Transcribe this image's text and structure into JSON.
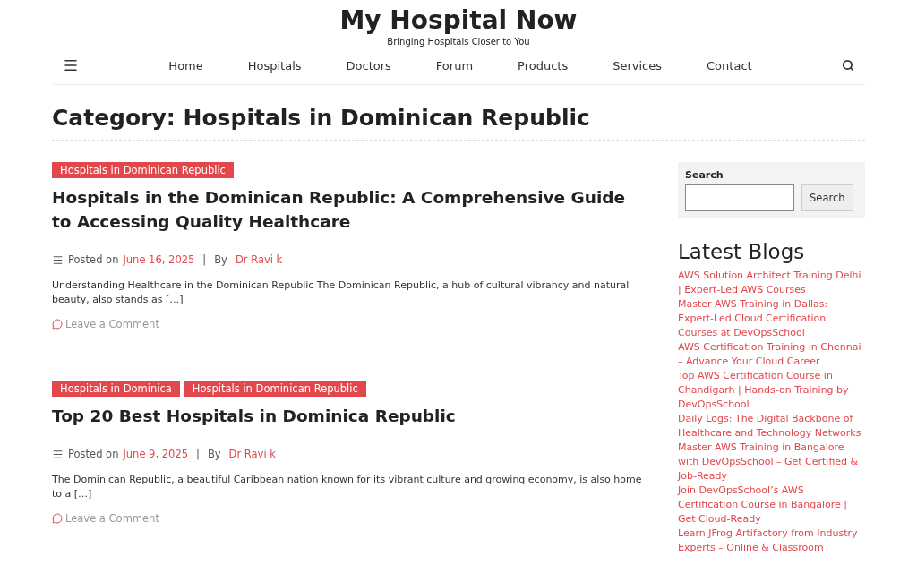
{
  "site": {
    "title": "My Hospital Now",
    "tagline": "Bringing Hospitals Closer to You"
  },
  "nav": [
    "Home",
    "Hospitals",
    "Doctors",
    "Forum",
    "Products",
    "Services",
    "Contact"
  ],
  "page_title": "Category: Hospitals in Dominican Republic",
  "posts": [
    {
      "tags": [
        "Hospitals in Dominican Republic"
      ],
      "title": "Hospitals in the Dominican Republic: A Comprehensive Guide to Accessing Quality Healthcare",
      "posted_label": "Posted on",
      "date": "June 16, 2025",
      "separator": "|",
      "by_label": "By",
      "author": "Dr Ravi k",
      "excerpt": "Understanding Healthcare in the Dominican Republic The Dominican Republic, a hub of cultural vibrancy and natural beauty, also stands as […]",
      "comment_link": "Leave a Comment"
    },
    {
      "tags": [
        "Hospitals in Dominica",
        "Hospitals in Dominican Republic"
      ],
      "title": "Top 20 Best Hospitals in Dominica Republic",
      "posted_label": "Posted on",
      "date": "June 9, 2025",
      "separator": "|",
      "by_label": "By",
      "author": "Dr Ravi k",
      "excerpt": "The Dominican Republic, a beautiful Caribbean nation known for its vibrant culture and growing economy, is also home to a […]",
      "comment_link": "Leave a Comment"
    }
  ],
  "sidebar": {
    "search": {
      "label": "Search",
      "button": "Search"
    },
    "latest_title": "Latest Blogs",
    "latest": [
      "AWS Solution Architect Training Delhi | Expert-Led AWS Courses",
      "Master AWS Training in Dallas: Expert-Led Cloud Certification Courses at DevOpsSchool",
      "AWS Certification Training in Chennai – Advance Your Cloud Career",
      "Top AWS Certification Course in Chandigarh | Hands-on Training by DevOpsSchool",
      "Daily Logs: The Digital Backbone of Healthcare and Technology Networks",
      "Master AWS Training in Bangalore with DevOpsSchool – Get Certified & Job-Ready",
      "Join DevOpsSchool’s AWS Certification Course in Bangalore | Get Cloud-Ready",
      "Learn JFrog Artifactory from Industry Experts – Online & Classroom"
    ]
  }
}
